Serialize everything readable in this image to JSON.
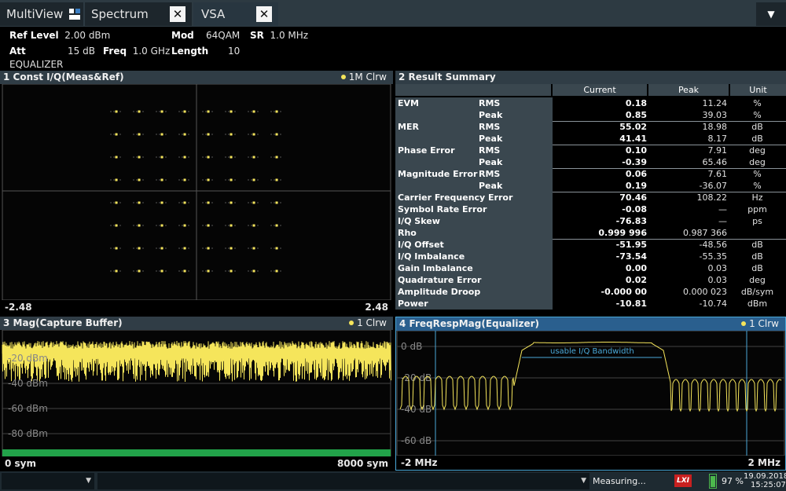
{
  "tabs": [
    {
      "label": "MultiView"
    },
    {
      "label": "Spectrum"
    },
    {
      "label": "VSA"
    }
  ],
  "header": {
    "ref_level_label": "Ref Level",
    "ref_level_value": "2.00 dBm",
    "att_label": "Att",
    "att_value": "15 dB",
    "freq_label": "Freq",
    "freq_value": "1.0 GHz",
    "mod_label": "Mod",
    "mod_value": "64QAM",
    "sr_label": "SR",
    "sr_value": "1.0 MHz",
    "length_label": "Length",
    "length_value": "10",
    "equalizer_label": "EQUALIZER"
  },
  "panel1": {
    "title": "1 Const I/Q(Meas&Ref)",
    "trace": "1M Clrw",
    "x_min": "-2.48",
    "x_max": "2.48"
  },
  "panel2": {
    "title": "2 Result Summary",
    "columns": [
      "Current",
      "Peak",
      "Unit"
    ],
    "rows": [
      {
        "name": "EVM",
        "sub": "RMS",
        "current": "0.18",
        "peak": "11.24",
        "unit": "%"
      },
      {
        "name": "",
        "sub": "Peak",
        "current": "0.85",
        "peak": "39.03",
        "unit": "%"
      },
      {
        "name": "MER",
        "sub": "RMS",
        "current": "55.02",
        "peak": "18.98",
        "unit": "dB"
      },
      {
        "name": "",
        "sub": "Peak",
        "current": "41.41",
        "peak": "8.17",
        "unit": "dB"
      },
      {
        "name": "Phase Error",
        "sub": "RMS",
        "current": "0.10",
        "peak": "7.91",
        "unit": "deg"
      },
      {
        "name": "",
        "sub": "Peak",
        "current": "-0.39",
        "peak": "65.46",
        "unit": "deg"
      },
      {
        "name": "Magnitude Error",
        "sub": "RMS",
        "current": "0.06",
        "peak": "7.61",
        "unit": "%"
      },
      {
        "name": "",
        "sub": "Peak",
        "current": "0.19",
        "peak": "-36.07",
        "unit": "%"
      },
      {
        "name": "Carrier Frequency Error",
        "sub": "",
        "current": "70.46",
        "peak": "108.22",
        "unit": "Hz"
      },
      {
        "name": "Symbol Rate Error",
        "sub": "",
        "current": "-0.08",
        "peak": "—",
        "unit": "ppm"
      },
      {
        "name": "I/Q Skew",
        "sub": "",
        "current": "-76.83",
        "peak": "—",
        "unit": "ps"
      },
      {
        "name": "Rho",
        "sub": "",
        "current": "0.999 996",
        "peak": "0.987 366",
        "unit": ""
      },
      {
        "name": "I/Q Offset",
        "sub": "",
        "current": "-51.95",
        "peak": "-48.56",
        "unit": "dB"
      },
      {
        "name": "I/Q Imbalance",
        "sub": "",
        "current": "-73.54",
        "peak": "-55.35",
        "unit": "dB"
      },
      {
        "name": "Gain Imbalance",
        "sub": "",
        "current": "0.00",
        "peak": "0.03",
        "unit": "dB"
      },
      {
        "name": "Quadrature Error",
        "sub": "",
        "current": "0.02",
        "peak": "0.03",
        "unit": "deg"
      },
      {
        "name": "Amplitude Droop",
        "sub": "",
        "current": "-0.000 00",
        "peak": "0.000 023",
        "unit": "dB/sym"
      },
      {
        "name": "Power",
        "sub": "",
        "current": "-10.81",
        "peak": "-10.74",
        "unit": "dBm"
      }
    ]
  },
  "panel3": {
    "title": "3 Mag(Capture Buffer)",
    "trace": "1 Clrw",
    "y_labels": [
      "-20 dBm",
      "-40 dBm",
      "-60 dBm",
      "-80 dBm"
    ],
    "x_min": "0 sym",
    "x_max": "8000 sym"
  },
  "panel4": {
    "title": "4 FreqRespMag(Equalizer)",
    "trace": "1 Clrw",
    "y_labels": [
      "0 dB",
      "-20 dB",
      "-40 dB",
      "-60 dB"
    ],
    "annotation": "usable I/Q Bandwidth",
    "x_min": "-2 MHz",
    "x_max": "2 MHz"
  },
  "status": {
    "measuring": "Measuring...",
    "logo": "LXI",
    "battery": "97 %",
    "date": "19.09.2018",
    "time": "15:25:07"
  },
  "colors": {
    "trace_yellow": "#f5e55b",
    "title_bar": "#303d46",
    "active_title_bar": "#2a5f8e",
    "progress_green": "#22a34a"
  }
}
